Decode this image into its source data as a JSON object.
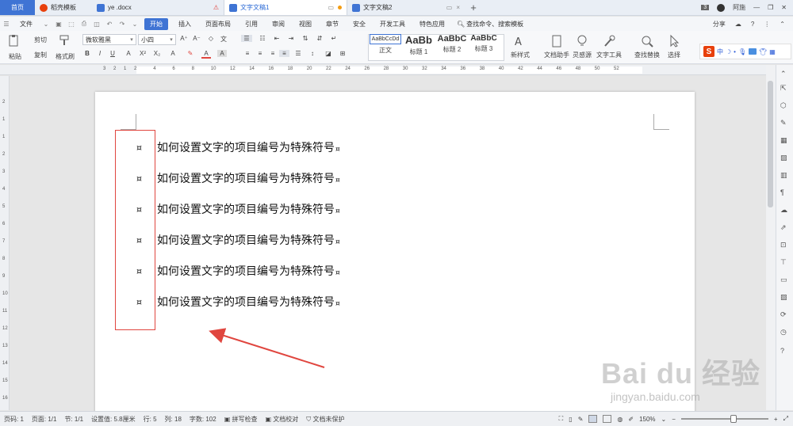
{
  "tabs": [
    {
      "label": "首页"
    },
    {
      "label": "稻壳模板"
    },
    {
      "label": "ye .docx"
    },
    {
      "label": "文字文稿1"
    },
    {
      "label": "文字文稿2"
    }
  ],
  "titlebar": {
    "badge": "3",
    "user": "阿施"
  },
  "menu": {
    "file": "文件",
    "items": [
      "开始",
      "插入",
      "页面布局",
      "引用",
      "审阅",
      "视图",
      "章节",
      "安全",
      "开发工具",
      "特色应用"
    ],
    "search": "查找命令、搜索模板",
    "share": "分享",
    "help": "?"
  },
  "ribbon": {
    "paste": "粘贴",
    "cut": "剪切",
    "copy": "复制",
    "format_painter": "格式刷",
    "font_name": "微软雅黑",
    "font_size": "小四",
    "styles": [
      {
        "preview": "AaBbCcDd",
        "label": "正文"
      },
      {
        "preview": "AaBb",
        "label": "标题 1"
      },
      {
        "preview": "AaBbC",
        "label": "标题 2"
      },
      {
        "preview": "AaBbC",
        "label": "标题 3"
      }
    ],
    "new_style": "新样式",
    "doc_helper": "文档助手",
    "inspiration": "灵感源",
    "text_tools": "文字工具",
    "find_replace": "查找替换",
    "select": "选择",
    "sogou_label": "中"
  },
  "ruler_numbers": [
    "3",
    "2",
    "1",
    "2",
    "4",
    "6",
    "8",
    "10",
    "12",
    "14",
    "16",
    "18",
    "20",
    "22",
    "24",
    "26",
    "28",
    "30",
    "32",
    "34",
    "36",
    "38",
    "40",
    "42",
    "44",
    "46",
    "48",
    "50",
    "52"
  ],
  "vruler_numbers": [
    "2",
    "1",
    "1",
    "2",
    "3",
    "4",
    "5",
    "6",
    "7",
    "8",
    "9",
    "10",
    "11",
    "12",
    "13",
    "14",
    "15",
    "16"
  ],
  "document": {
    "bullet": "¤",
    "lines": [
      "如何设置文字的项目编号为特殊符号",
      "如何设置文字的项目编号为特殊符号",
      "如何设置文字的项目编号为特殊符号",
      "如何设置文字的项目编号为特殊符号",
      "如何设置文字的项目编号为特殊符号",
      "如何设置文字的项目编号为特殊符号"
    ],
    "para_mark": "¤"
  },
  "status": {
    "page_num": "页码: 1",
    "page": "页面: 1/1",
    "section": "节: 1/1",
    "set_value": "设置值: 5.8厘米",
    "row": "行: 5",
    "col": "列: 18",
    "words": "字数: 102",
    "spell": "拼写检查",
    "proof": "文档校对",
    "protect": "文档未保护",
    "zoom": "150%"
  },
  "watermark": {
    "main": "Bai du 经验",
    "sub": "jingyan.baidu.com"
  },
  "colors": {
    "accent": "#3f74d4",
    "highlight": "#e0463f"
  }
}
